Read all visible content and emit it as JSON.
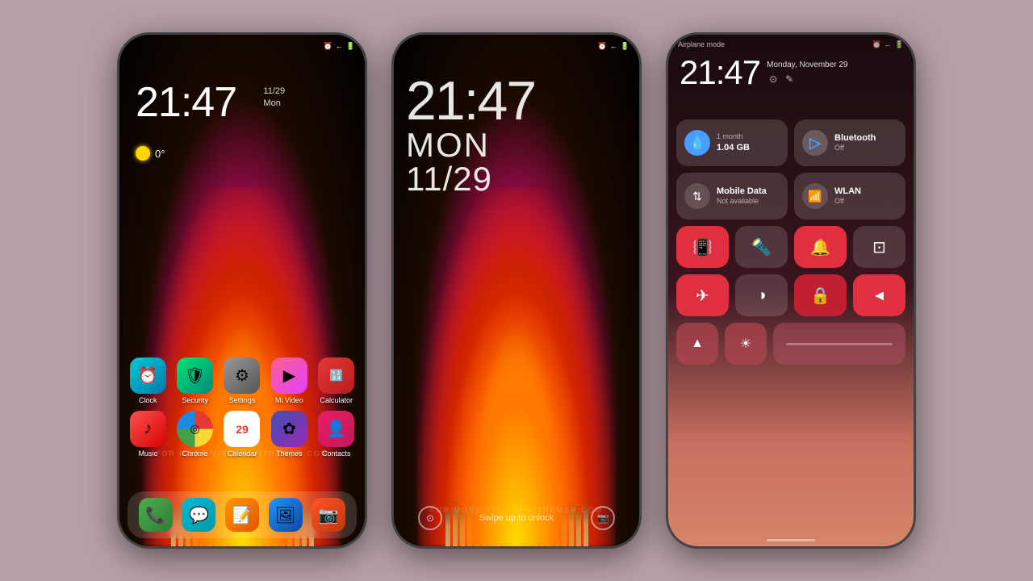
{
  "background": "#b8a0a8",
  "phone1": {
    "time": "21:47",
    "date_line1": "11/29",
    "date_line2": "Mon",
    "temperature": "0°",
    "apps_row1": [
      {
        "id": "clock",
        "label": "Clock",
        "class": "ic-clock",
        "icon": "⏰"
      },
      {
        "id": "security",
        "label": "Security",
        "class": "ic-security",
        "icon": "🛡"
      },
      {
        "id": "settings",
        "label": "Settings",
        "class": "ic-settings",
        "icon": "⚙"
      },
      {
        "id": "mivideo",
        "label": "Mi Video",
        "class": "ic-mivideo",
        "icon": "▶"
      },
      {
        "id": "calculator",
        "label": "Calculator",
        "class": "ic-calc",
        "icon": "🔢"
      }
    ],
    "apps_row2": [
      {
        "id": "music",
        "label": "Music",
        "class": "ic-music",
        "icon": "♪"
      },
      {
        "id": "chrome",
        "label": "Chrome",
        "class": "ic-chrome",
        "icon": "◎"
      },
      {
        "id": "calendar",
        "label": "Calendar",
        "class": "ic-calendar",
        "icon": "29"
      },
      {
        "id": "themes",
        "label": "Themes",
        "class": "ic-themes",
        "icon": "✿"
      },
      {
        "id": "contacts",
        "label": "Contacts",
        "class": "ic-contacts",
        "icon": "👤"
      }
    ],
    "dock": [
      {
        "id": "phone",
        "class": "ic-phone",
        "icon": "📞"
      },
      {
        "id": "msg",
        "class": "ic-msg",
        "icon": "💬"
      },
      {
        "id": "notes",
        "class": "ic-notes",
        "icon": "📝"
      },
      {
        "id": "gallery",
        "class": "ic-gallery",
        "icon": "🖼"
      },
      {
        "id": "scanner",
        "class": "ic-scanner",
        "icon": "📷"
      }
    ],
    "watermark": "FOR MORE VISIT MIUITHEMER.COM"
  },
  "phone2": {
    "time": "21:47",
    "day": "MON",
    "date": "11/29",
    "swipe_text": "Swipe up to unlock",
    "watermark": "FOR MORE VISIT MIUITHEMER.COM"
  },
  "phone3": {
    "airplane_mode": "Airplane mode",
    "time": "21:47",
    "date": "Monday, November 29",
    "data_usage": "1.04 GB",
    "data_period": "1 month",
    "bluetooth_label": "Bluetooth",
    "bluetooth_status": "Off",
    "mobile_data_label": "Mobile Data",
    "mobile_data_status": "Not available",
    "wlan_label": "WLAN",
    "wlan_status": "Off",
    "buttons": [
      {
        "id": "vibrate",
        "icon": "📳",
        "type": "red"
      },
      {
        "id": "flashlight",
        "icon": "🔦",
        "type": "dark"
      },
      {
        "id": "dnd",
        "icon": "🔔",
        "type": "red"
      },
      {
        "id": "screen-record",
        "icon": "⊡",
        "type": "dark"
      },
      {
        "id": "airplane",
        "icon": "✈",
        "type": "red"
      },
      {
        "id": "invert",
        "icon": "◑",
        "type": "dark"
      },
      {
        "id": "lock-rotation",
        "icon": "🔒",
        "type": "dark-red"
      },
      {
        "id": "location",
        "icon": "◄",
        "type": "red"
      }
    ]
  }
}
